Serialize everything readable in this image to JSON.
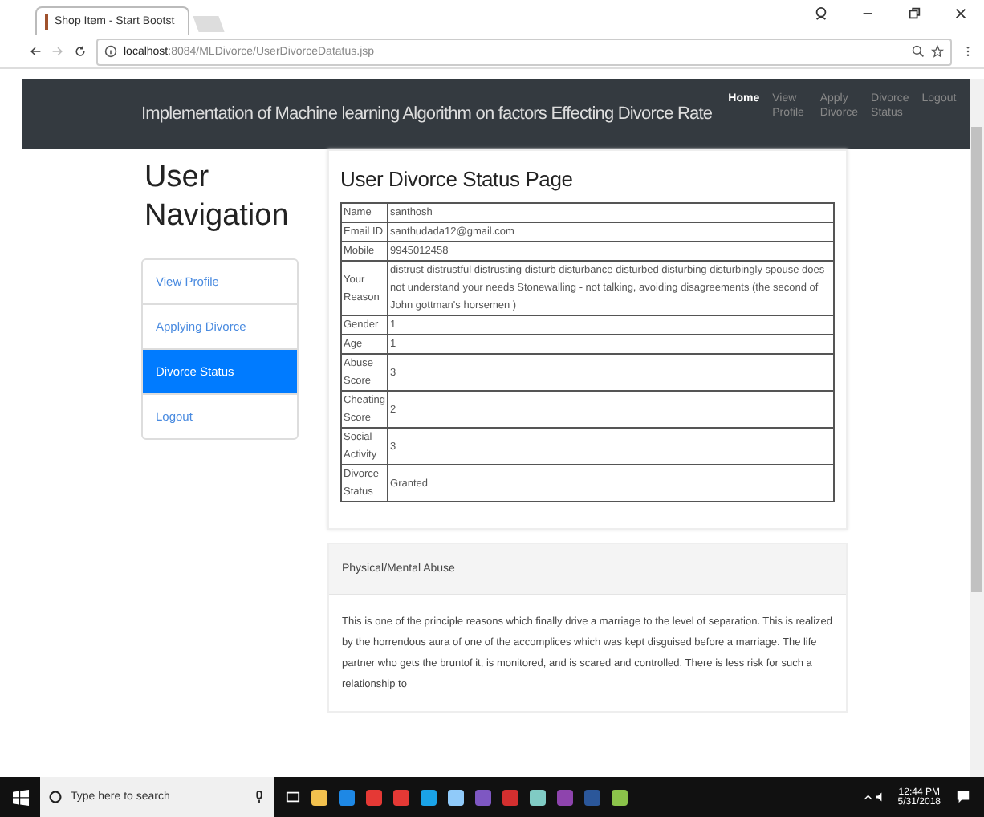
{
  "browser": {
    "tab_title": "Shop Item - Start Bootst",
    "url_host": "localhost",
    "url_path": ":8084/MLDivorce/UserDivorceDatatus.jsp"
  },
  "navbar": {
    "brand": "Implementation of Machine learning Algorithm on factors Effecting Divorce Rate",
    "links": [
      {
        "label": "Home",
        "selected": true
      },
      {
        "label": "View Profile",
        "selected": false
      },
      {
        "label": "Apply Divorce",
        "selected": false
      },
      {
        "label": "Divorce Status",
        "selected": false
      },
      {
        "label": "Logout",
        "selected": false
      }
    ]
  },
  "sidebar": {
    "title": "User Navigation",
    "items": [
      {
        "label": "View Profile",
        "selected": false
      },
      {
        "label": "Applying Divorce",
        "selected": false
      },
      {
        "label": "Divorce Status",
        "selected": true
      },
      {
        "label": "Logout",
        "selected": false
      }
    ]
  },
  "main": {
    "title": "User Divorce Status Page",
    "rows": [
      {
        "label": "Name",
        "value": "santhosh"
      },
      {
        "label": "Email ID",
        "value": "santhudada12@gmail.com"
      },
      {
        "label": "Mobile",
        "value": "9945012458"
      },
      {
        "label": "Your Reason",
        "value": "distrust distrustful distrusting disturb disturbance disturbed disturbing disturbingly spouse does not understand your needs Stonewalling - not talking, avoiding disagreements (the second of John gottman's horsemen )"
      },
      {
        "label": "Gender",
        "value": "1"
      },
      {
        "label": "Age",
        "value": "1"
      },
      {
        "label": "Abuse Score",
        "value": "3"
      },
      {
        "label": "Cheating Score",
        "value": "2"
      },
      {
        "label": "Social Activity",
        "value": "3"
      },
      {
        "label": "Divorce Status",
        "value": "Granted"
      }
    ]
  },
  "info_card": {
    "header": "Physical/Mental Abuse",
    "body": "This is one of the principle reasons which finally drive a marriage to the level of separation. This is realized by the horrendous aura of one of the accomplices which was kept disguised before a marriage. The life partner who gets the bruntof it, is monitored, and is scared and controlled. There is less risk for such a relationship to"
  },
  "taskbar": {
    "search_placeholder": "Type here to search",
    "time": "12:44 PM",
    "date": "5/31/2018"
  }
}
